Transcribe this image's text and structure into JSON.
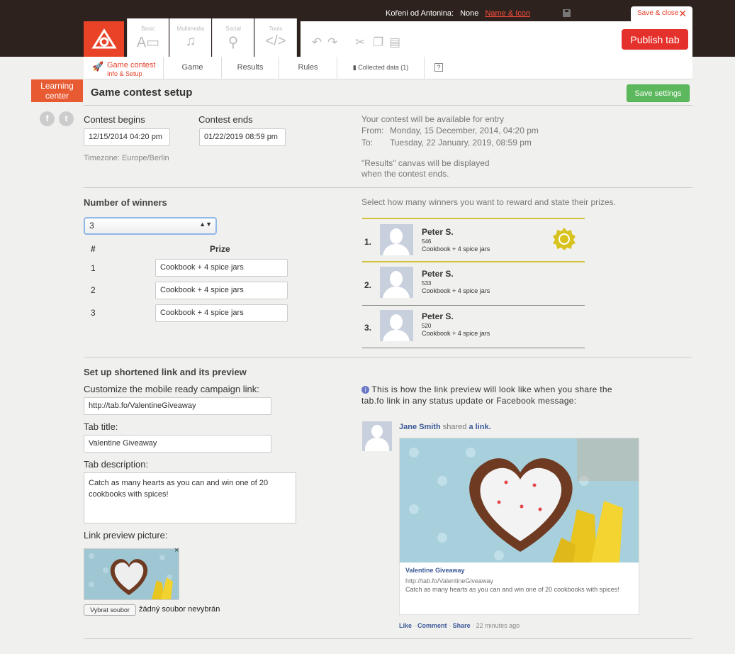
{
  "header": {
    "account_name": "Kořeni od Antonina:",
    "account_value": "None",
    "name_icon_link": "Name & Icon",
    "save_close": "Save & close",
    "publish": "Publish tab",
    "tool_groups": [
      "Basic",
      "Multimedia",
      "Social",
      "Tools"
    ]
  },
  "subnav": {
    "active_title": "Game contest",
    "active_sub": "Info & Setup",
    "tabs": [
      "Game",
      "Results",
      "Rules",
      "Collected data (1)"
    ],
    "help": "?"
  },
  "sidebar": {
    "learning_center": "Learning center"
  },
  "page": {
    "title": "Game contest setup",
    "save_settings": "Save settings"
  },
  "dates": {
    "begins_label": "Contest begins",
    "begins_value": "12/15/2014 04:20 pm",
    "ends_label": "Contest ends",
    "ends_value": "01/22/2019 08:59 pm",
    "timezone": "Timezone: Europe/Berlin",
    "info_line1": "Your contest will be available for entry",
    "from_label": "From:",
    "from_value": "Monday, 15 December, 2014, 04:20 pm",
    "to_label": "To:",
    "to_value": "Tuesday, 22 January, 2019, 08:59 pm",
    "results_note_1": "\"Results\" canvas will be displayed",
    "results_note_2": "when the contest ends."
  },
  "winners": {
    "heading": "Number of winners",
    "selected": "3",
    "info": "Select how many winners you want to reward and state their prizes.",
    "col_num": "#",
    "col_prize": "Prize",
    "prizes": [
      {
        "n": "1",
        "prize": "Cookbook + 4 spice jars"
      },
      {
        "n": "2",
        "prize": "Cookbook + 4 spice jars"
      },
      {
        "n": "3",
        "prize": "Cookbook + 4 spice jars"
      }
    ],
    "preview": [
      {
        "rank": "1.",
        "name": "Peter S.",
        "score": "546",
        "prize": "Cookbook + 4 spice jars"
      },
      {
        "rank": "2.",
        "name": "Peter S.",
        "score": "533",
        "prize": "Cookbook + 4 spice jars"
      },
      {
        "rank": "3.",
        "name": "Peter S.",
        "score": "520",
        "prize": "Cookbook + 4 spice jars"
      }
    ]
  },
  "link": {
    "heading": "Set up shortened link and its preview",
    "url_label": "Customize the mobile ready campaign link:",
    "url_value": "http://tab.fo/ValentineGiveaway",
    "title_label": "Tab title:",
    "title_value": "Valentine Giveaway",
    "desc_label": "Tab description:",
    "desc_value": "Catch as many hearts as you can and win one of 20 cookbooks with spices!",
    "pic_label": "Link preview picture:",
    "file_button": "Vybrat soubor",
    "file_text": "žádný soubor nevybrán",
    "close": "×"
  },
  "fb_preview": {
    "info_icon": "i",
    "info": "This is how the link preview will look like when you share the tab.fo link in any status update or Facebook message:",
    "user": "Jane Smith",
    "shared": "shared",
    "a_link": "a link.",
    "card_title": "Valentine Giveaway",
    "card_url": "http://tab.fo/ValentineGiveaway",
    "card_desc": "Catch as many hearts as you can and win one of 20 cookbooks with spices!",
    "like": "Like",
    "comment": "Comment",
    "share": "Share",
    "time": "22 minutes ago",
    "sep": "·"
  }
}
